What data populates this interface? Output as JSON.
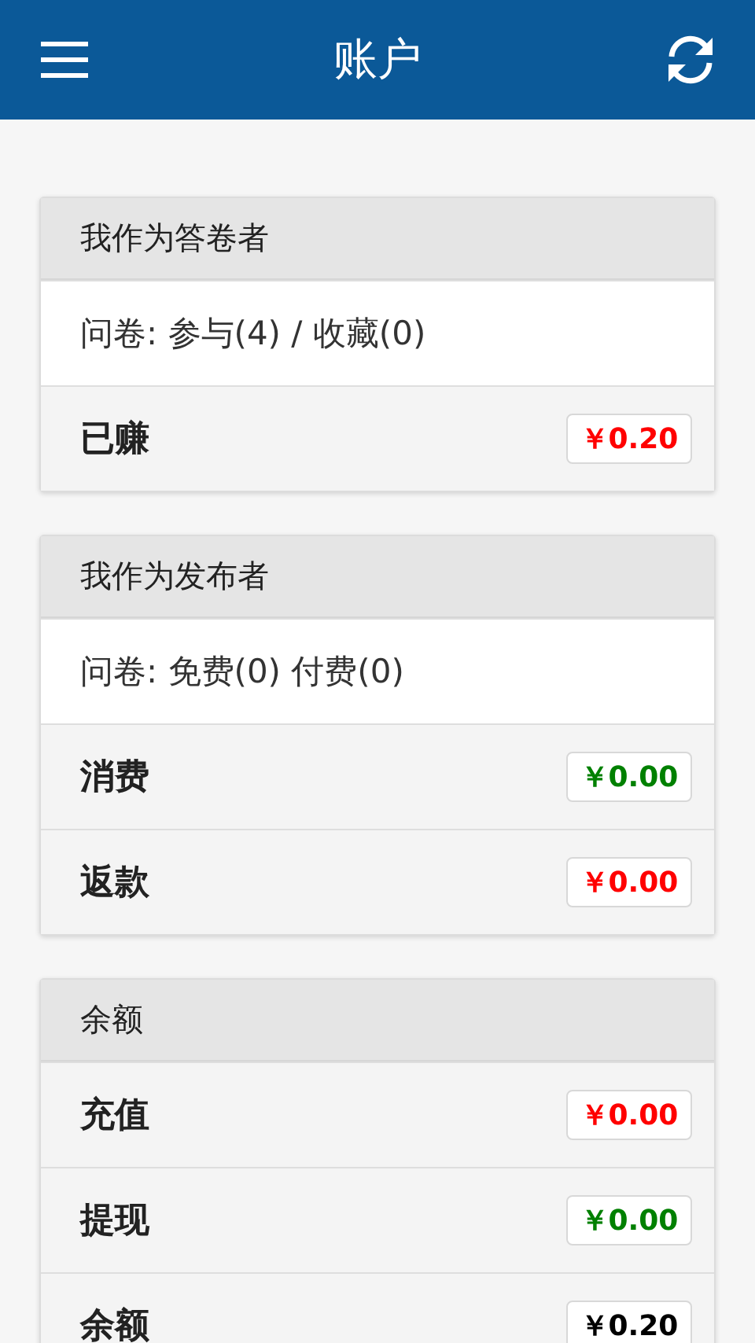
{
  "header": {
    "title": "账户"
  },
  "cards": [
    {
      "title": "我作为答卷者",
      "rows": [
        {
          "kind": "info",
          "text": "问卷: 参与(4) / 收藏(0)"
        },
        {
          "kind": "amount",
          "label": "已赚",
          "amount": "￥0.20",
          "color": "#ff0000"
        }
      ]
    },
    {
      "title": "我作为发布者",
      "rows": [
        {
          "kind": "info",
          "text": "问卷: 免费(0) 付费(0)"
        },
        {
          "kind": "amount",
          "label": "消费",
          "amount": "￥0.00",
          "color": "#008000"
        },
        {
          "kind": "amount",
          "label": "返款",
          "amount": "￥0.00",
          "color": "#ff0000"
        }
      ]
    },
    {
      "title": "余额",
      "rows": [
        {
          "kind": "amount",
          "label": "充值",
          "amount": "￥0.00",
          "color": "#ff0000"
        },
        {
          "kind": "amount",
          "label": "提现",
          "amount": "￥0.00",
          "color": "#008000"
        },
        {
          "kind": "amount",
          "label": "余额",
          "amount": "￥0.20",
          "color": "#000000"
        }
      ]
    }
  ]
}
